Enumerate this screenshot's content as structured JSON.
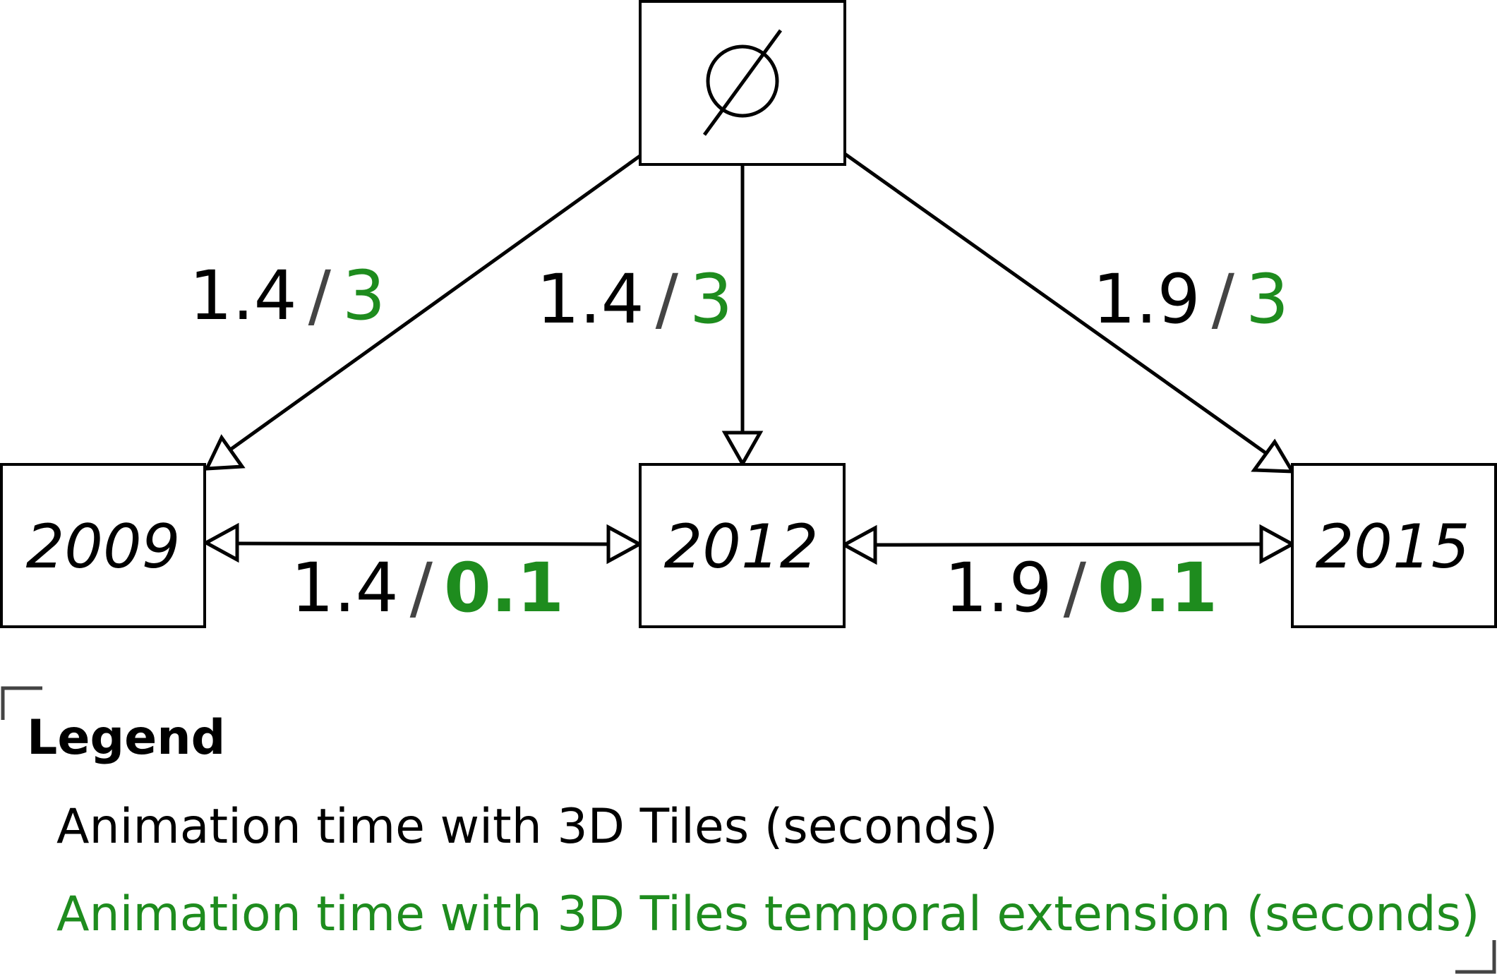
{
  "diagram": {
    "root_node": {
      "symbol": "∅"
    },
    "nodes": [
      {
        "id": "n2009",
        "label": "2009"
      },
      {
        "id": "n2012",
        "label": "2012"
      },
      {
        "id": "n2015",
        "label": "2015"
      }
    ],
    "edges": [
      {
        "from": "root",
        "to": "2009",
        "tiles_time": "1.4",
        "separator": "/",
        "temporal_time": "3"
      },
      {
        "from": "root",
        "to": "2012",
        "tiles_time": "1.4",
        "separator": "/",
        "temporal_time": "3"
      },
      {
        "from": "root",
        "to": "2015",
        "tiles_time": "1.9",
        "separator": "/",
        "temporal_time": "3"
      },
      {
        "from": "2009",
        "to": "2012",
        "bidirectional": true,
        "tiles_time": "1.4",
        "separator": "/",
        "temporal_time": "0.1"
      },
      {
        "from": "2012",
        "to": "2015",
        "bidirectional": true,
        "tiles_time": "1.9",
        "separator": "/",
        "temporal_time": "0.1"
      }
    ]
  },
  "legend": {
    "title": "Legend",
    "items": [
      {
        "text": "Animation time with 3D Tiles (seconds)",
        "color": "#000000"
      },
      {
        "text": "Animation time with 3D Tiles temporal extension (seconds)",
        "color": "#1e8c1e"
      }
    ]
  },
  "colors": {
    "tiles": "#000000",
    "temporal": "#1e8c1e",
    "separator": "#444444"
  }
}
